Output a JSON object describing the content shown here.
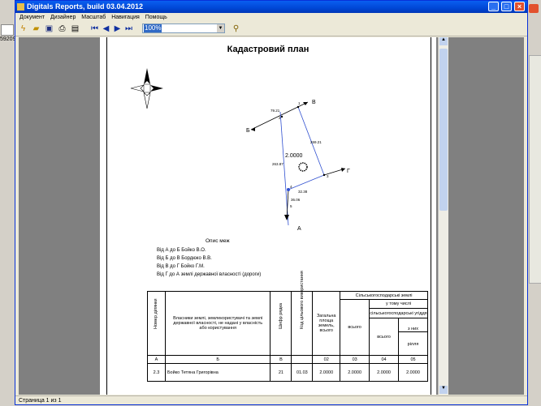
{
  "window": {
    "title": "Digitals Reports, build 03.04.2012"
  },
  "menu": [
    "Документ",
    "Дизайнер",
    "Масштаб",
    "Навигация",
    "Помощь"
  ],
  "toolbar": {
    "zoom": "100%"
  },
  "background_app": {
    "left_text": "59209"
  },
  "status": "Страница 1 из 1",
  "report": {
    "title": "Кадастровий план",
    "plan": {
      "area": "2.0000",
      "points": [
        "А",
        "Б",
        "В",
        "Г"
      ],
      "edges": [
        "79.21",
        "269.21",
        "263.87",
        "32.38",
        "36.06"
      ],
      "vertex_labels": [
        "2",
        "1",
        "3",
        "4",
        "5"
      ]
    },
    "description": {
      "heading": "Опис меж",
      "rows": [
        "Від А до Б  Бойко В.О.",
        "Від Б до В  Бордюко В.В.",
        "Від В до Г  Бойко Г.М.",
        "Від Г до А  землі державної власності (дороги)"
      ]
    },
    "table": {
      "headers": {
        "num": "Номер ділянки",
        "owners": "Власники землі, землекористувачі та землі державної власності, не надані у власність або користування",
        "code": "Шифр рядка",
        "use_code": "Код цільового використання",
        "total": "Загальна площа земель, всього",
        "agri": "Сільськогосподарські землі",
        "agri_total": "всього",
        "including": "у тому числі",
        "agri_lands": "сільськогосподарські угіддя",
        "agri_lands_total": "всього",
        "of_them": "з них",
        "arable": "рілля"
      },
      "index_row": [
        "А",
        "Б",
        "В",
        "02",
        "03",
        "04",
        "05"
      ],
      "rows": [
        [
          "2.3",
          "Бойко Тетяна Григорівна",
          "21",
          "01.03",
          "2.0000",
          "2.0000",
          "2.0000",
          "2.0000"
        ]
      ]
    }
  }
}
